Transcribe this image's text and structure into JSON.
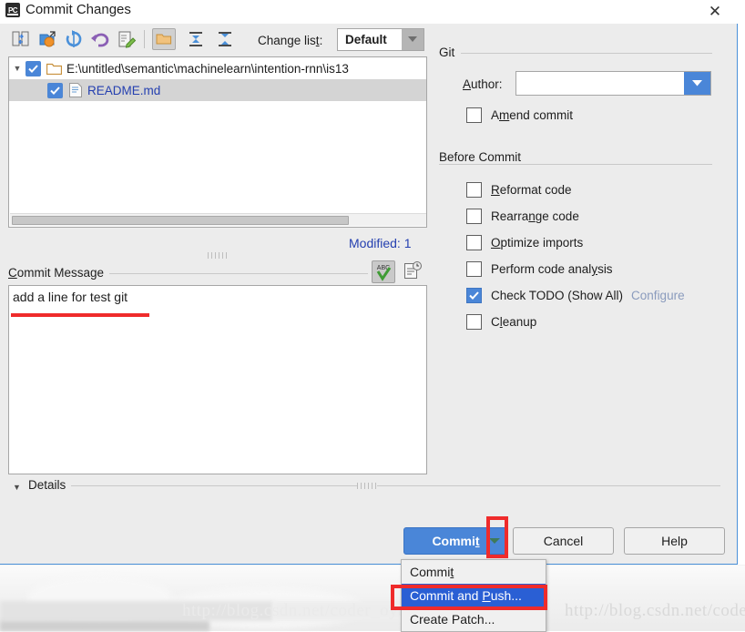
{
  "window": {
    "title": "Commit Changes",
    "app_icon": "pycharm-icon",
    "close_label": "✕"
  },
  "toolbar": {
    "icons": [
      {
        "name": "show-diff-icon",
        "title": "Show Diff"
      },
      {
        "name": "move-to-changelist-icon",
        "title": "Move to Another Changelist"
      },
      {
        "name": "refresh-icon",
        "title": "Refresh"
      },
      {
        "name": "revert-icon",
        "title": "Revert"
      },
      {
        "name": "edit-source-icon",
        "title": "Edit Source"
      },
      {
        "name": "group-by-directory-icon",
        "title": "Group by Directory"
      },
      {
        "name": "expand-all-icon",
        "title": "Expand All"
      },
      {
        "name": "collapse-all-icon",
        "title": "Collapse All"
      }
    ],
    "changelist_label": "Change list:",
    "changelist_value": "Default"
  },
  "changes_tree": {
    "root": {
      "label": "E:\\untitled\\semantic\\machinelearn\\intention-rnn\\is13",
      "checked": true,
      "expanded": true
    },
    "files": [
      {
        "label": "README.md",
        "checked": true,
        "selected": true
      }
    ],
    "status": "Modified: 1"
  },
  "commit_message": {
    "label": "Commit Message",
    "value": "add a line for test git",
    "spellcheck_icon": "spellcheck-icon",
    "history_icon": "message-history-icon"
  },
  "details": {
    "label": "Details",
    "expanded": true
  },
  "git_panel": {
    "group_label": "Git",
    "author_label": "Author:",
    "author_value": "",
    "amend_label": "Amend commit",
    "amend_checked": false
  },
  "before_commit": {
    "group_label": "Before Commit",
    "options": [
      {
        "label": "Reformat code",
        "checked": false
      },
      {
        "label": "Rearrange code",
        "checked": false
      },
      {
        "label": "Optimize imports",
        "checked": false
      },
      {
        "label": "Perform code analysis",
        "checked": false
      },
      {
        "label": "Check TODO (Show All)",
        "checked": true,
        "link": "Configure"
      },
      {
        "label": "Cleanup",
        "checked": false
      }
    ]
  },
  "buttons": {
    "commit": "Commit",
    "cancel": "Cancel",
    "help": "Help"
  },
  "commit_menu": {
    "items": [
      {
        "label": "Commit",
        "selected": false
      },
      {
        "label": "Commit and Push...",
        "selected": true
      },
      {
        "label": "Create Patch...",
        "selected": false
      }
    ]
  },
  "watermark": {
    "text": "http://blog.csdn.net/coder_oyang"
  },
  "colors": {
    "accent_blue": "#4a86d8",
    "menu_highlight": "#2a5fd4",
    "annotation_red": "#ef2b2b",
    "status_blue": "#2540b0",
    "dialog_bg": "#ececec"
  }
}
